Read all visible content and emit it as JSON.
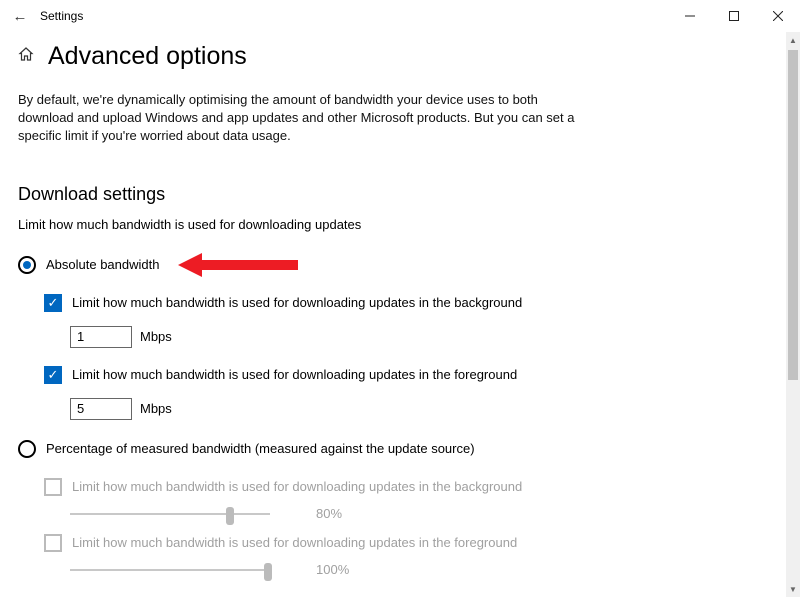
{
  "window": {
    "title": "Settings"
  },
  "header": {
    "title": "Advanced options"
  },
  "intro": "By default, we're dynamically optimising the amount of bandwidth your device uses to both download and upload Windows and app updates and other Microsoft products. But you can set a specific limit if you're worried about data usage.",
  "download": {
    "heading": "Download settings",
    "subtext": "Limit how much bandwidth is used for downloading updates",
    "absolute": {
      "label": "Absolute bandwidth",
      "bg_check_label": "Limit how much bandwidth is used for downloading updates in the background",
      "bg_value": "1",
      "bg_unit": "Mbps",
      "fg_check_label": "Limit how much bandwidth is used for downloading updates in the foreground",
      "fg_value": "5",
      "fg_unit": "Mbps"
    },
    "percentage": {
      "label": "Percentage of measured bandwidth (measured against the update source)",
      "bg_check_label": "Limit how much bandwidth is used for downloading updates in the background",
      "bg_value": "80%",
      "fg_check_label": "Limit how much bandwidth is used for downloading updates in the foreground",
      "fg_value": "100%"
    }
  }
}
